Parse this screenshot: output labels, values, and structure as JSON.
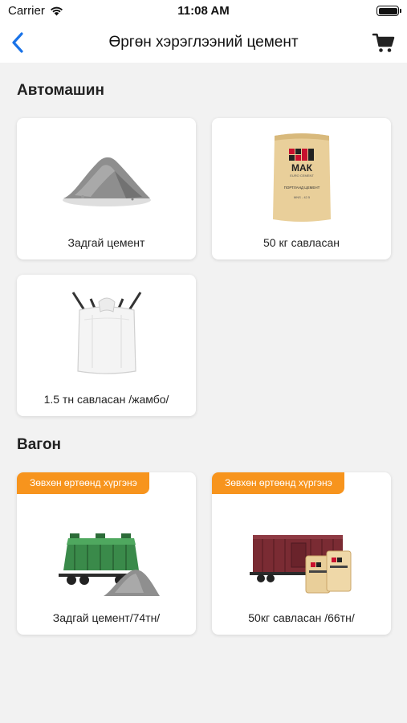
{
  "status": {
    "carrier": "Carrier",
    "time": "11:08 AM"
  },
  "nav": {
    "title": "Өргөн хэрэглээний цемент"
  },
  "sections": [
    {
      "title": "Автомашин",
      "items": [
        {
          "label": "Задгай цемент"
        },
        {
          "label": "50 кг савласан"
        },
        {
          "label": "1.5 тн савласан /жамбо/"
        }
      ]
    },
    {
      "title": "Вагон",
      "items": [
        {
          "label": "Задгай цемент/74тн/",
          "badge": "Зөвхөн өртөөнд хүргэнэ"
        },
        {
          "label": "50кг савласан /66тн/",
          "badge": "Зөвхөн өртөөнд хүргэнэ"
        }
      ]
    }
  ],
  "bag": {
    "brand": "МАК",
    "sub": "EURO CEMENT",
    "text": "ПОРТЛАНД ЦЕМЕНТ",
    "text2": "MNS - 42.5"
  },
  "icons": [
    "wifi-icon",
    "battery-icon",
    "back-chevron-icon",
    "cart-icon"
  ],
  "colors": {
    "accent": "#1a73e8",
    "badge": "#f7941d",
    "background": "#f2f2f2"
  }
}
